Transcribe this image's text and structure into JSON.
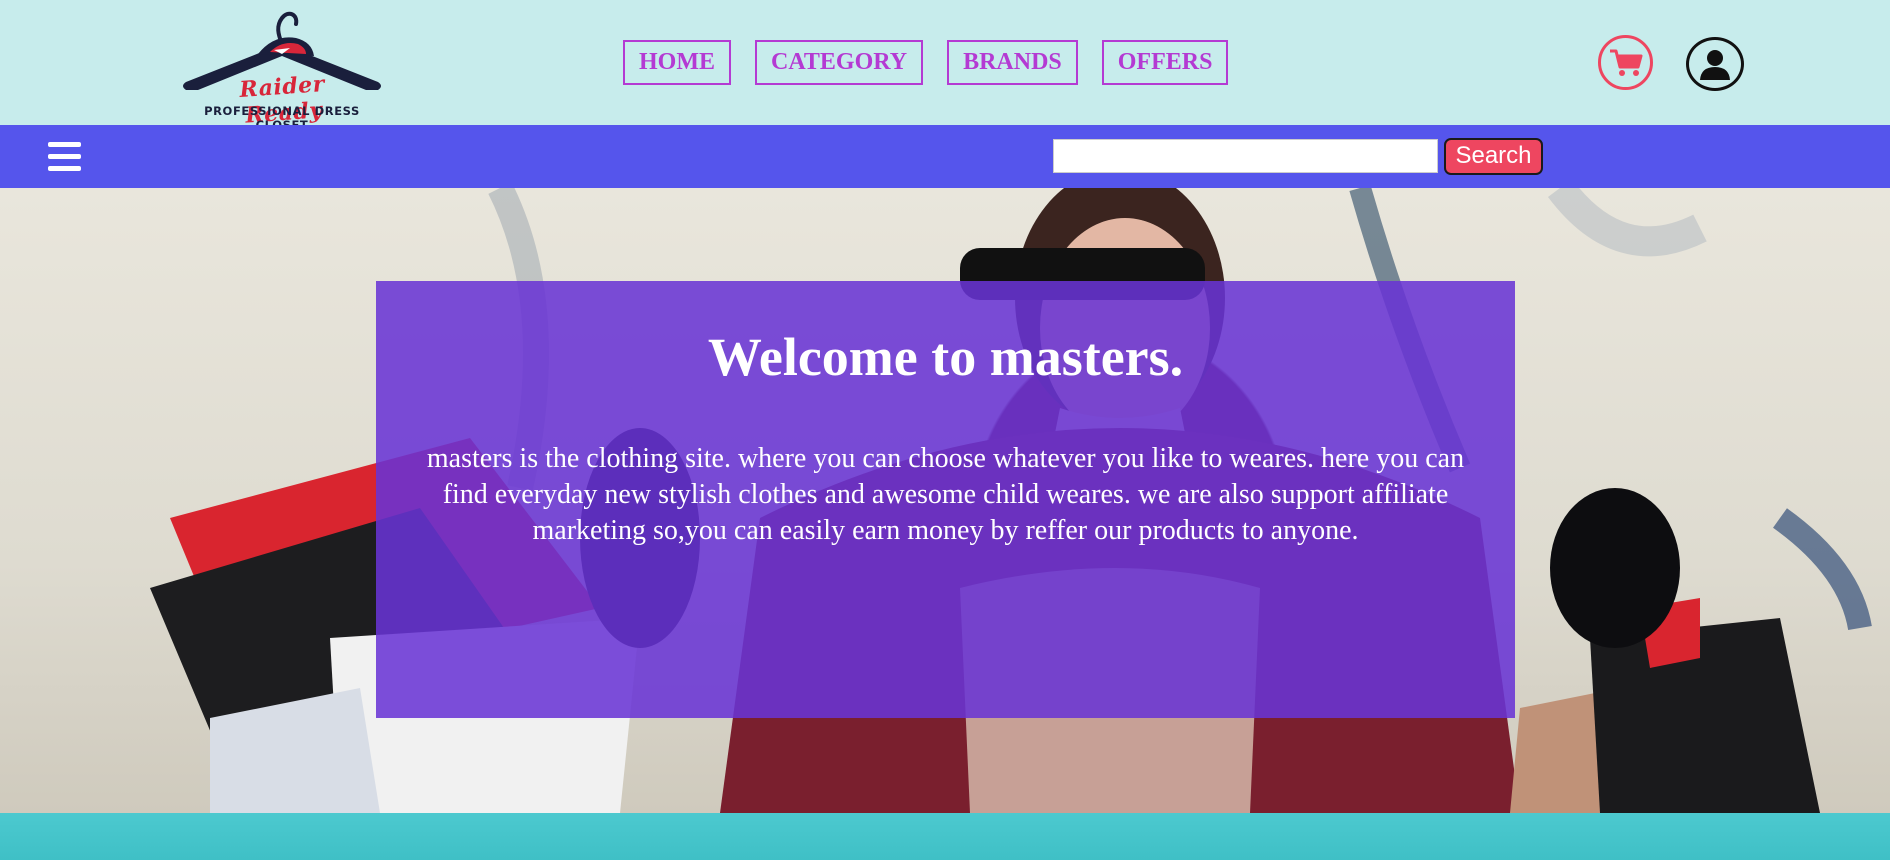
{
  "brand": {
    "script_name": "Raider Ready",
    "tagline": "PROFESSIONAL DRESS CLOSET"
  },
  "nav": {
    "items": [
      {
        "label": "HOME"
      },
      {
        "label": "CATEGORY"
      },
      {
        "label": "BRANDS"
      },
      {
        "label": "OFFERS"
      }
    ]
  },
  "header_icons": {
    "cart": "cart-icon",
    "account": "user-icon"
  },
  "search": {
    "value": "",
    "placeholder": "",
    "button_label": "Search"
  },
  "hero": {
    "title": "Welcome to masters.",
    "body": "masters is the clothing site. where you can choose whatever you like to weares. here you can find everyday new stylish clothes and awesome child weares. we are also support affiliate marketing so,you can easily earn money by reffer our products to anyone."
  },
  "colors": {
    "header_bg": "#c7ecec",
    "nav_accent": "#b43ad3",
    "bar_bg": "#5555ec",
    "search_button": "#ee4660",
    "overlay": "#6834d5",
    "footer_strip": "#4cc9cf"
  }
}
